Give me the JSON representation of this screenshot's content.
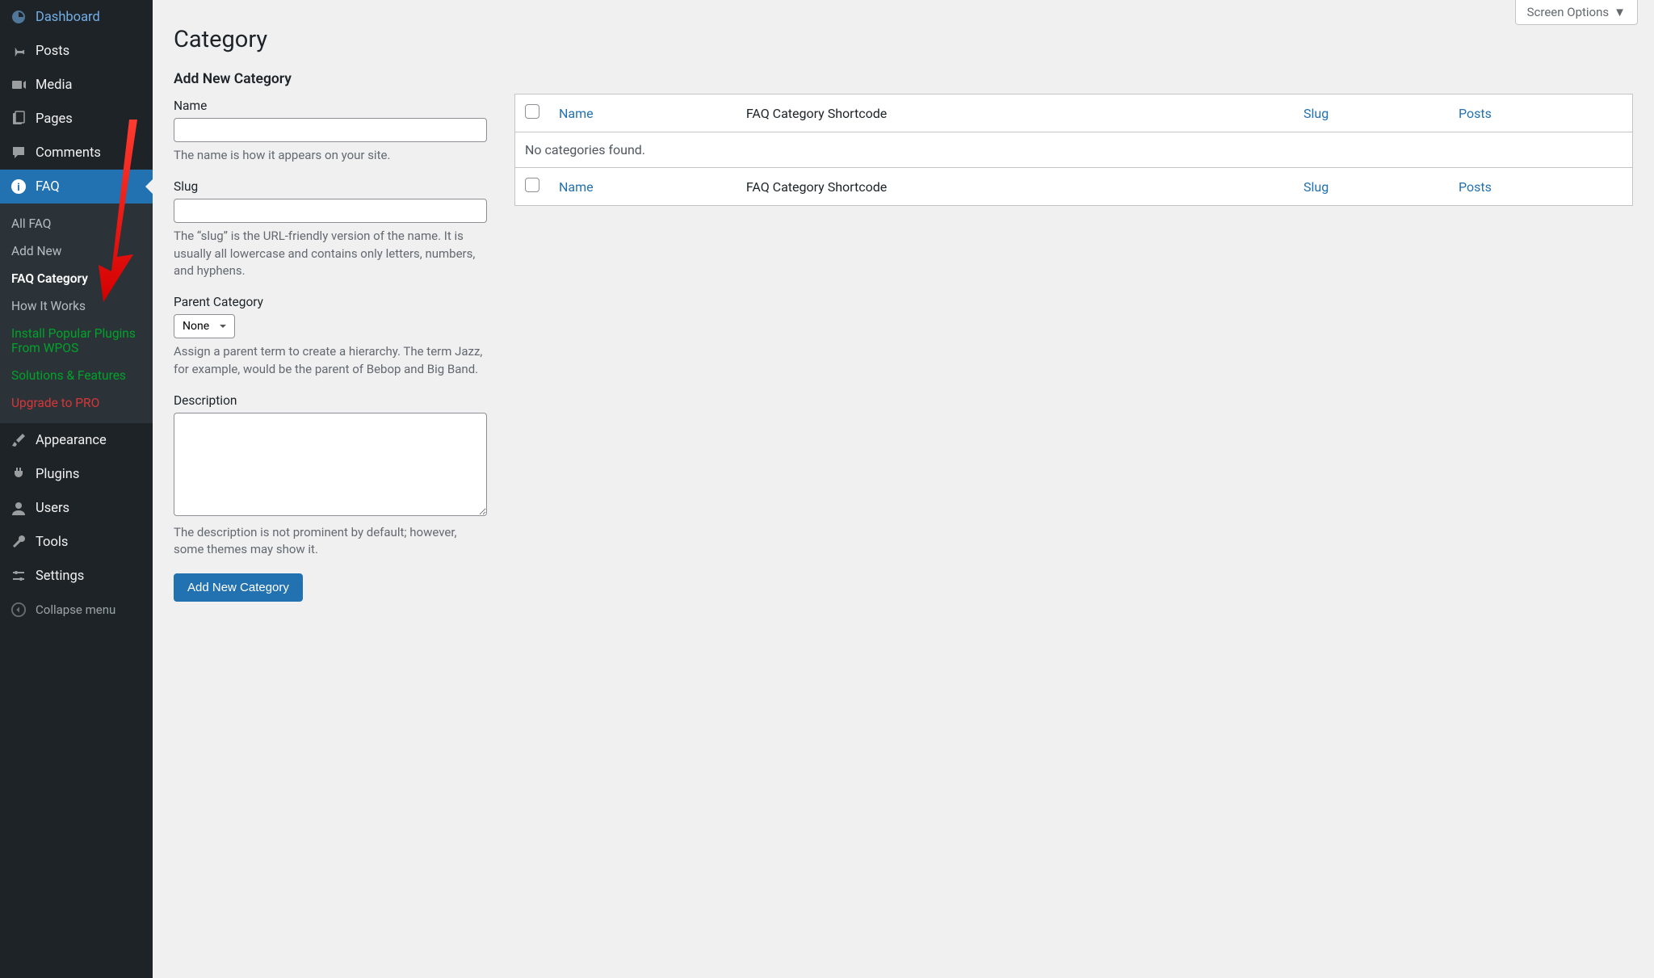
{
  "sidebar": {
    "items": [
      {
        "label": "Dashboard"
      },
      {
        "label": "Posts"
      },
      {
        "label": "Media"
      },
      {
        "label": "Pages"
      },
      {
        "label": "Comments"
      },
      {
        "label": "FAQ"
      },
      {
        "label": "Appearance"
      },
      {
        "label": "Plugins"
      },
      {
        "label": "Users"
      },
      {
        "label": "Tools"
      },
      {
        "label": "Settings"
      }
    ],
    "submenu": {
      "all_faq": "All FAQ",
      "add_new": "Add New",
      "faq_category": "FAQ Category",
      "how_it_works": "How It Works",
      "install_plugins": "Install Popular Plugins From WPOS",
      "solutions": "Solutions & Features",
      "upgrade": "Upgrade to PRO"
    },
    "collapse": "Collapse menu"
  },
  "header": {
    "screen_options": "Screen Options"
  },
  "page": {
    "title": "Category",
    "section_title": "Add New Category"
  },
  "form": {
    "name_label": "Name",
    "name_desc": "The name is how it appears on your site.",
    "slug_label": "Slug",
    "slug_desc": "The “slug” is the URL-friendly version of the name. It is usually all lowercase and contains only letters, numbers, and hyphens.",
    "parent_label": "Parent Category",
    "parent_option_none": "None",
    "parent_desc": "Assign a parent term to create a hierarchy. The term Jazz, for example, would be the parent of Bebop and Big Band.",
    "description_label": "Description",
    "description_desc": "The description is not prominent by default; however, some themes may show it.",
    "submit_label": "Add New Category"
  },
  "table": {
    "col_name": "Name",
    "col_shortcode": "FAQ Category Shortcode",
    "col_slug": "Slug",
    "col_posts": "Posts",
    "empty": "No categories found."
  }
}
